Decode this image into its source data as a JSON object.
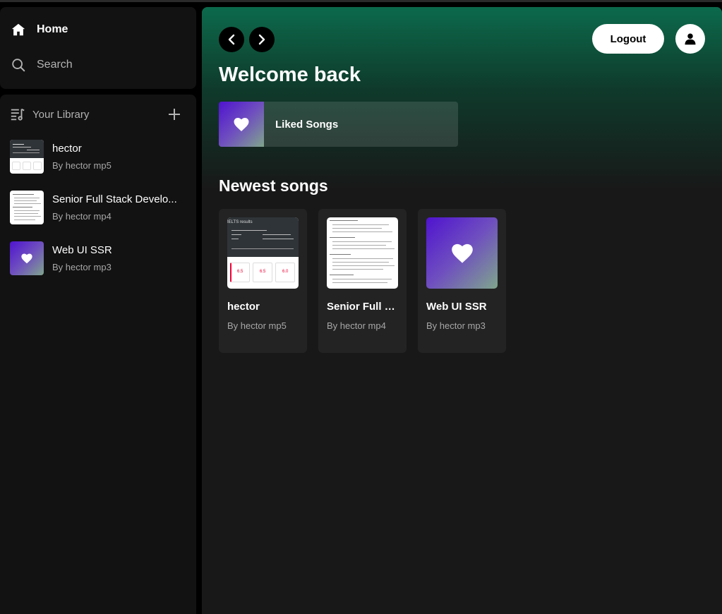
{
  "sidebar": {
    "nav": {
      "home_label": "Home",
      "search_label": "Search"
    },
    "library": {
      "title": "Your Library",
      "items": [
        {
          "title": "hector",
          "subtitle": "By hector mp5"
        },
        {
          "title": "Senior Full Stack Develo...",
          "subtitle": "By hector mp4"
        },
        {
          "title": "Web UI SSR",
          "subtitle": "By hector mp3"
        }
      ]
    }
  },
  "header": {
    "logout_label": "Logout",
    "welcome": "Welcome back"
  },
  "liked": {
    "label": "Liked Songs"
  },
  "newest": {
    "title": "Newest songs",
    "cards": [
      {
        "title": "hector",
        "subtitle": "By hector mp5"
      },
      {
        "title": "Senior Full S...",
        "subtitle": "By hector mp4"
      },
      {
        "title": "Web UI SSR",
        "subtitle": "By hector mp3"
      }
    ]
  },
  "thumb_text": {
    "doc_heading": "IELTS results",
    "scores": [
      "6.5",
      "6.5",
      "6.0"
    ]
  },
  "colors": {
    "accent_green": "#0c6a4c",
    "panel": "#121212",
    "main_bg": "#181818",
    "card_bg": "#232323",
    "gradient_start": "#4f13cf",
    "gradient_end": "#7fa58c"
  },
  "icons": {
    "home": "home-icon",
    "search": "search-icon",
    "library": "library-icon",
    "plus": "plus-icon",
    "back": "chevron-left-icon",
    "forward": "chevron-right-icon",
    "user": "user-icon",
    "heart": "heart-icon"
  }
}
